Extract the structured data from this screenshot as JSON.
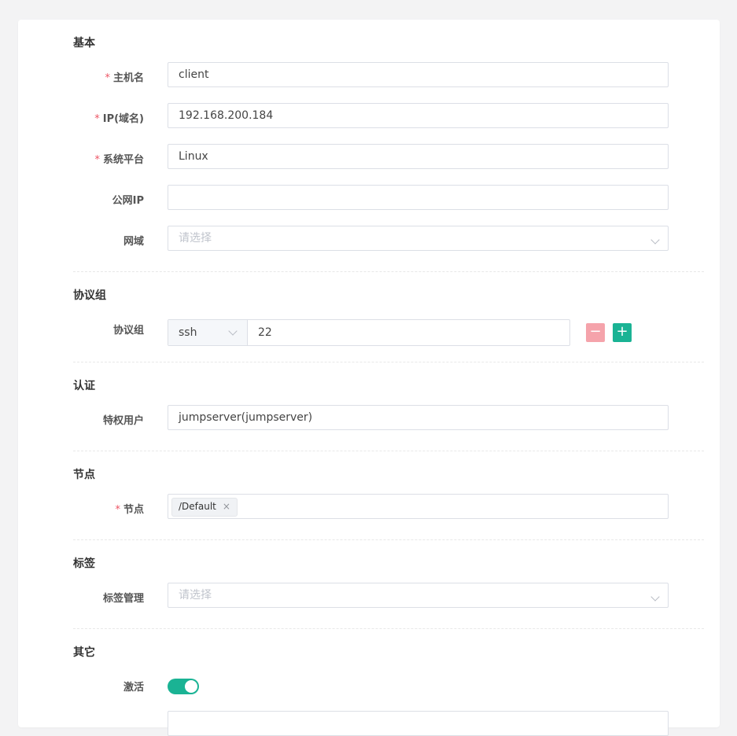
{
  "sections": {
    "basic": "基本",
    "protocol": "协议组",
    "auth": "认证",
    "nodes": "节点",
    "labels": "标签",
    "other": "其它"
  },
  "fields": {
    "hostname": {
      "label": "主机名",
      "required_mark": "*",
      "value": "client"
    },
    "ip": {
      "label": "IP(域名)",
      "required_mark": "*",
      "value": "192.168.200.184"
    },
    "platform": {
      "label": "系统平台",
      "required_mark": "*",
      "value": "Linux"
    },
    "public_ip": {
      "label": "公网IP",
      "value": ""
    },
    "domain": {
      "label": "网域",
      "placeholder": "请选择"
    },
    "protocols": {
      "label": "协议组",
      "protocol": "ssh",
      "port": "22",
      "remove_label": "−",
      "add_label": "+"
    },
    "admin_user": {
      "label": "特权用户",
      "value": "jumpserver(jumpserver)"
    },
    "nodes": {
      "label": "节点",
      "required_mark": "*",
      "tag": "/Default",
      "tag_close": "×"
    },
    "labels": {
      "label": "标签管理",
      "placeholder": "请选择"
    },
    "is_active": {
      "label": "激活",
      "on": true
    }
  },
  "colors": {
    "accent": "#1ab394",
    "danger_light": "#f5a3ab",
    "required": "#ed5565"
  }
}
